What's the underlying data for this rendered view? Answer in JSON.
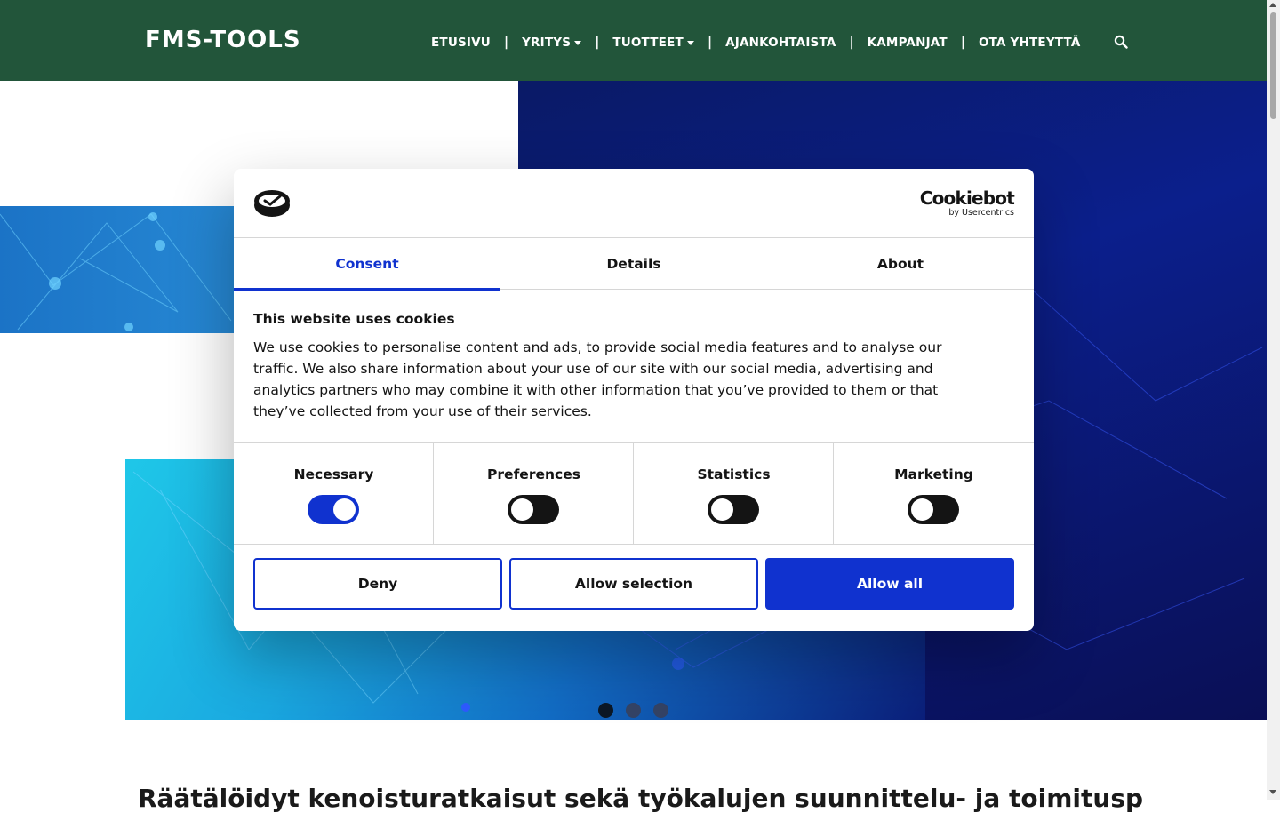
{
  "header": {
    "logo_text": "FMS-TOOLS",
    "nav": [
      {
        "label": "ETUSIVU",
        "has_dropdown": false
      },
      {
        "label": "YRITYS",
        "has_dropdown": true
      },
      {
        "label": "TUOTTEET",
        "has_dropdown": true
      },
      {
        "label": "AJANKOHTAISTA",
        "has_dropdown": false
      },
      {
        "label": "KAMPANJAT",
        "has_dropdown": false
      },
      {
        "label": "OTA YHTEYTTÄ",
        "has_dropdown": false
      }
    ],
    "separator": "|",
    "search_icon": "search-icon",
    "background_color": "#22553a"
  },
  "hero": {
    "slider_dots": 3,
    "active_dot": 1
  },
  "page": {
    "headline": "Räätälöidyt kenoisturatkaisut sekä työkalujen suunnittelu- ja toimituspalvelut"
  },
  "cookie_dialog": {
    "brand_name": "Cookiebot",
    "brand_sub": "by Usercentrics",
    "tabs": [
      {
        "label": "Consent",
        "active": true
      },
      {
        "label": "Details",
        "active": false
      },
      {
        "label": "About",
        "active": false
      }
    ],
    "title": "This website uses cookies",
    "body": "We use cookies to personalise content and ads, to provide social media features and to analyse our traffic. We also share information about your use of our site with our social media, advertising and analytics partners who may combine it with other information that you’ve provided to them or that they’ve collected from your use of their services.",
    "toggles": [
      {
        "label": "Necessary",
        "on": true
      },
      {
        "label": "Preferences",
        "on": false
      },
      {
        "label": "Statistics",
        "on": false
      },
      {
        "label": "Marketing",
        "on": false
      }
    ],
    "buttons": {
      "deny": "Deny",
      "allow_selection": "Allow selection",
      "allow_all": "Allow all"
    },
    "accent_color": "#1032cf"
  }
}
